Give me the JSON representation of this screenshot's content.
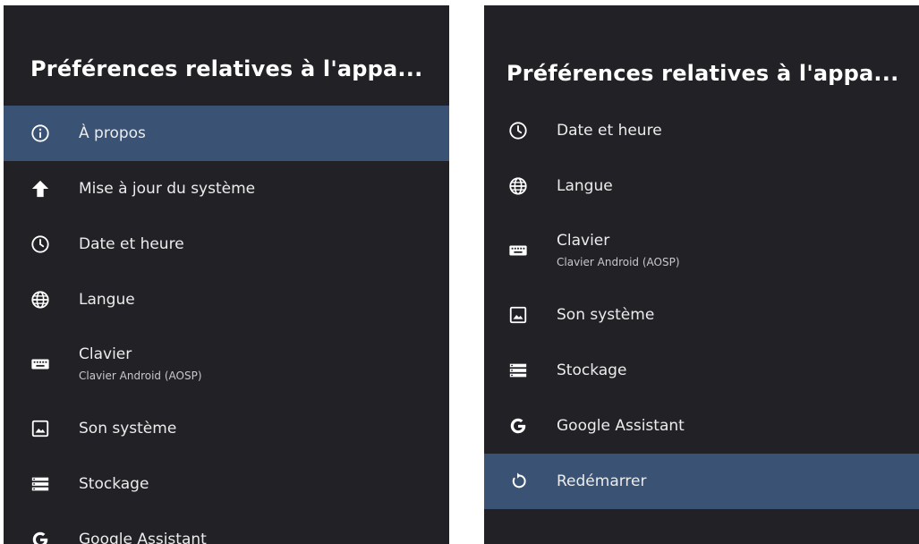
{
  "left_panel": {
    "title": "Préférences relatives à l'appa...",
    "items": [
      {
        "icon": "info-icon",
        "label": "À propos",
        "selected": true
      },
      {
        "icon": "arrow-up-icon",
        "label": "Mise à jour du système"
      },
      {
        "icon": "clock-icon",
        "label": "Date et heure"
      },
      {
        "icon": "globe-icon",
        "label": "Langue"
      },
      {
        "icon": "keyboard-icon",
        "label": "Clavier",
        "sublabel": "Clavier Android (AOSP)"
      },
      {
        "icon": "image-icon",
        "label": "Son système"
      },
      {
        "icon": "storage-icon",
        "label": "Stockage"
      },
      {
        "icon": "google-icon",
        "label": "Google Assistant"
      }
    ]
  },
  "right_panel": {
    "title": "Préférences relatives à l'appa...",
    "items": [
      {
        "icon": "clock-icon",
        "label": "Date et heure"
      },
      {
        "icon": "globe-icon",
        "label": "Langue"
      },
      {
        "icon": "keyboard-icon",
        "label": "Clavier",
        "sublabel": "Clavier Android (AOSP)"
      },
      {
        "icon": "image-icon",
        "label": "Son système"
      },
      {
        "icon": "storage-icon",
        "label": "Stockage"
      },
      {
        "icon": "google-icon",
        "label": "Google Assistant"
      },
      {
        "icon": "restart-icon",
        "label": "Redémarrer",
        "selected": true
      }
    ]
  },
  "colors": {
    "panel_bg": "#212126",
    "selected_bg": "#3a5273",
    "text": "#ececec"
  }
}
